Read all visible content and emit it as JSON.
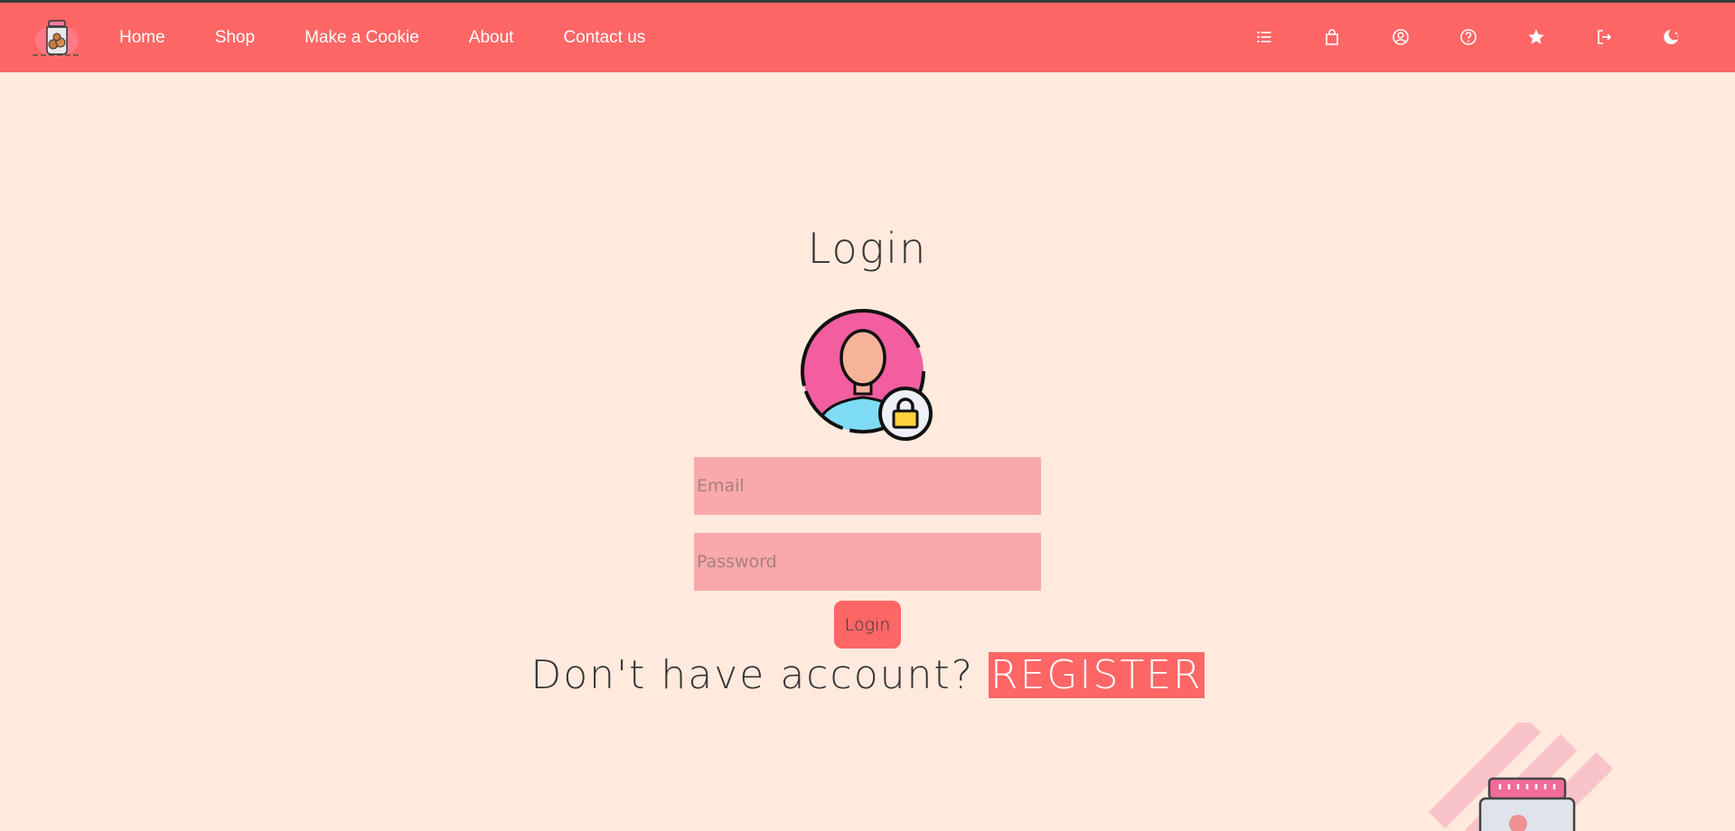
{
  "nav": {
    "links": [
      {
        "label": "Home"
      },
      {
        "label": "Shop"
      },
      {
        "label": "Make a Cookie"
      },
      {
        "label": "About"
      },
      {
        "label": "Contact us"
      }
    ],
    "icons": [
      "list-icon",
      "shopping-bag-icon",
      "user-circle-icon",
      "help-icon",
      "star-icon",
      "logout-icon",
      "theme-toggle-icon"
    ]
  },
  "login": {
    "title": "Login",
    "email_placeholder": "Email",
    "password_placeholder": "Password",
    "button_label": "Login",
    "register_prompt": "Don't have account?",
    "register_label": "REGISTER"
  },
  "colors": {
    "navbar": "#ff6666",
    "background": "#ffeadd",
    "input_bg": "#f9a9a9",
    "accent": "#ff6666"
  }
}
